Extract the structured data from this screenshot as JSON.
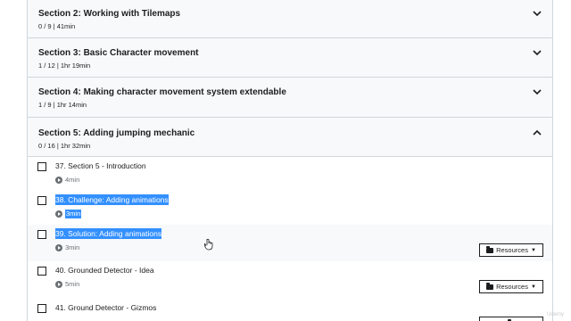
{
  "sections": [
    {
      "title": "Section 2: Working with Tilemaps",
      "meta": "0 / 9 | 41min",
      "expanded": false
    },
    {
      "title": "Section 3: Basic Character movement",
      "meta": "1 / 12 | 1hr 19min",
      "expanded": false
    },
    {
      "title": "Section 4: Making character movement system extendable",
      "meta": "1 / 9 | 1hr 14min",
      "expanded": false
    },
    {
      "title": "Section 5: Adding jumping mechanic",
      "meta": "0 / 16 | 1hr 32min",
      "expanded": true
    }
  ],
  "lectures": [
    {
      "title": "37. Section 5 - Introduction",
      "duration": "4min"
    },
    {
      "title": "38. Challenge: Adding animations",
      "duration": "3min"
    },
    {
      "title": "39. Solution: Adding animations",
      "duration": "3min",
      "resources_label": "Resources"
    },
    {
      "title": "40. Grounded Detector - Idea",
      "duration": "5min",
      "resources_label": "Resources"
    },
    {
      "title": "41. Ground Detector - Gizmos",
      "duration": "",
      "resources_label": ""
    }
  ],
  "icons": {
    "chevron_down": "chevron-down-icon",
    "chevron_up": "chevron-up-icon",
    "play": "play-circle-icon",
    "folder": "folder-icon",
    "caret": "caret-down-icon"
  },
  "watermark": "Udemy",
  "colors": {
    "selection": "#3390ff",
    "section_bg": "#f7f9fa",
    "border": "#d1d7dc",
    "text": "#1c1d1f",
    "muted": "#6a6f73"
  }
}
